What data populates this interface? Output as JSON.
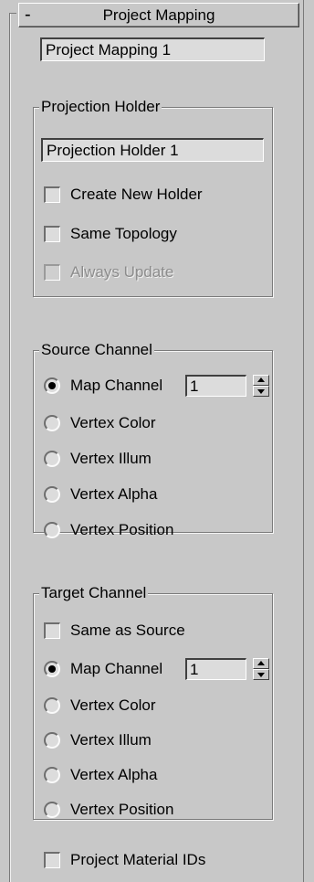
{
  "rollout": {
    "collapse_symbol": "-",
    "title": "Project Mapping"
  },
  "mapping_name": "Project Mapping 1",
  "projection_holder": {
    "group_title": "Projection Holder",
    "name": "Projection Holder 1",
    "create_new_holder": {
      "label": "Create New Holder",
      "checked": false
    },
    "same_topology": {
      "label": "Same Topology",
      "checked": false
    },
    "always_update": {
      "label": "Always Update",
      "checked": false,
      "enabled": false
    }
  },
  "source_channel": {
    "group_title": "Source Channel",
    "map_channel": {
      "label": "Map Channel",
      "value": "1",
      "selected": true
    },
    "vertex_color": {
      "label": "Vertex Color",
      "selected": false
    },
    "vertex_illum": {
      "label": "Vertex Illum",
      "selected": false
    },
    "vertex_alpha": {
      "label": "Vertex Alpha",
      "selected": false
    },
    "vertex_position": {
      "label": "Vertex Position",
      "selected": false
    }
  },
  "target_channel": {
    "group_title": "Target Channel",
    "same_as_source": {
      "label": "Same as Source",
      "checked": false
    },
    "map_channel": {
      "label": "Map Channel",
      "value": "1",
      "selected": true
    },
    "vertex_color": {
      "label": "Vertex Color",
      "selected": false
    },
    "vertex_illum": {
      "label": "Vertex Illum",
      "selected": false
    },
    "vertex_alpha": {
      "label": "Vertex Alpha",
      "selected": false
    },
    "vertex_position": {
      "label": "Vertex Position",
      "selected": false
    }
  },
  "project_material_ids": {
    "label": "Project Material IDs",
    "checked": false
  },
  "colors": {
    "panel_bg": "#c8c8c8",
    "field_bg": "#dcdcdc",
    "disabled_text": "#8c8c8c"
  }
}
